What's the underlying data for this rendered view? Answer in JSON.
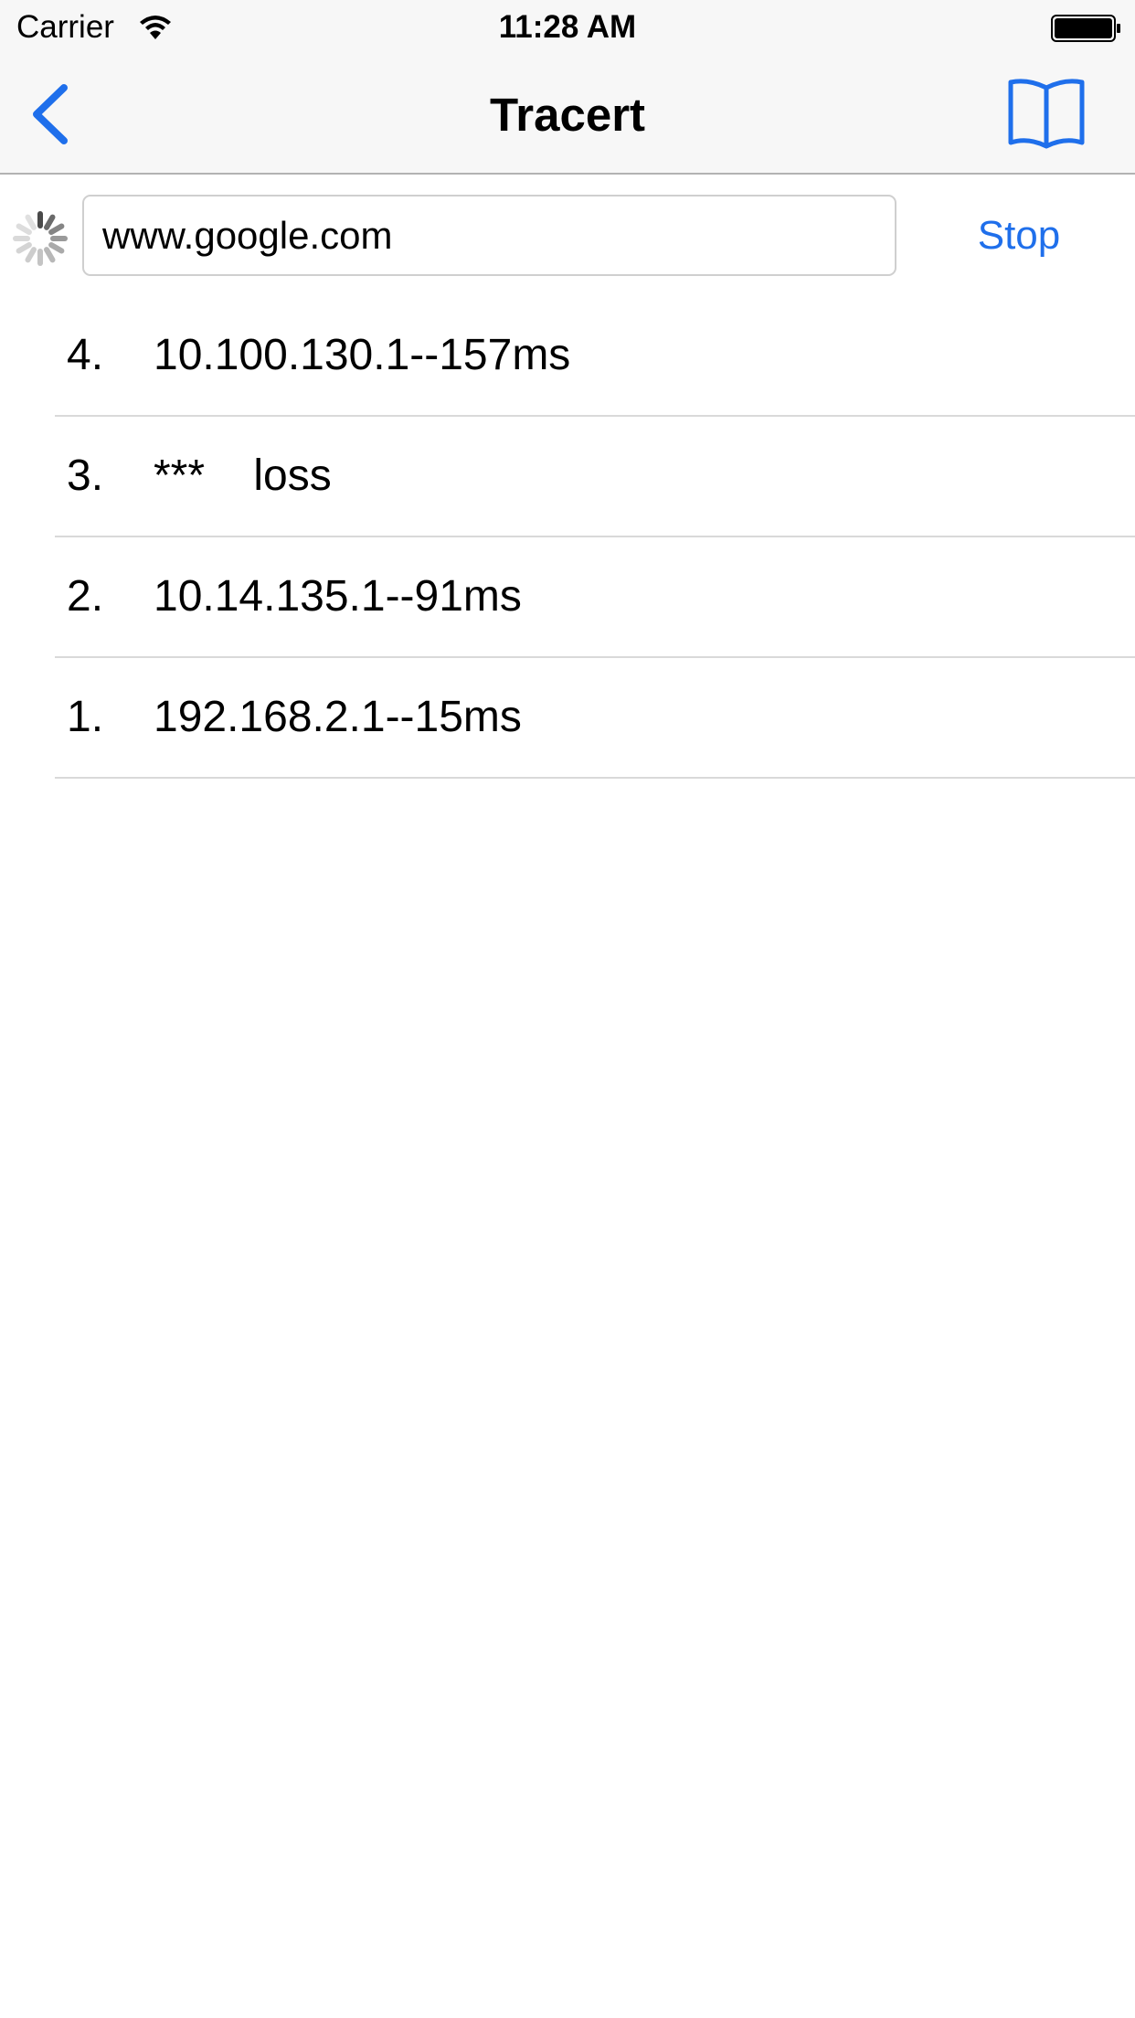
{
  "status_bar": {
    "carrier": "Carrier",
    "time": "11:28 AM",
    "wifi_icon": "wifi-icon",
    "battery_icon": "battery-full-icon"
  },
  "nav": {
    "title": "Tracert",
    "back_icon": "chevron-left-icon",
    "bookmark_icon": "book-icon",
    "accent_color": "#1f6feb"
  },
  "search": {
    "value": "www.google.com",
    "placeholder": "",
    "stop_label": "Stop",
    "activity_icon": "spinner-icon"
  },
  "hops": [
    {
      "index": "4.",
      "text": "10.100.130.1--157ms"
    },
    {
      "index": "3.",
      "text": "***    loss"
    },
    {
      "index": "2.",
      "text": "10.14.135.1--91ms"
    },
    {
      "index": "1.",
      "text": "192.168.2.1--15ms"
    }
  ]
}
